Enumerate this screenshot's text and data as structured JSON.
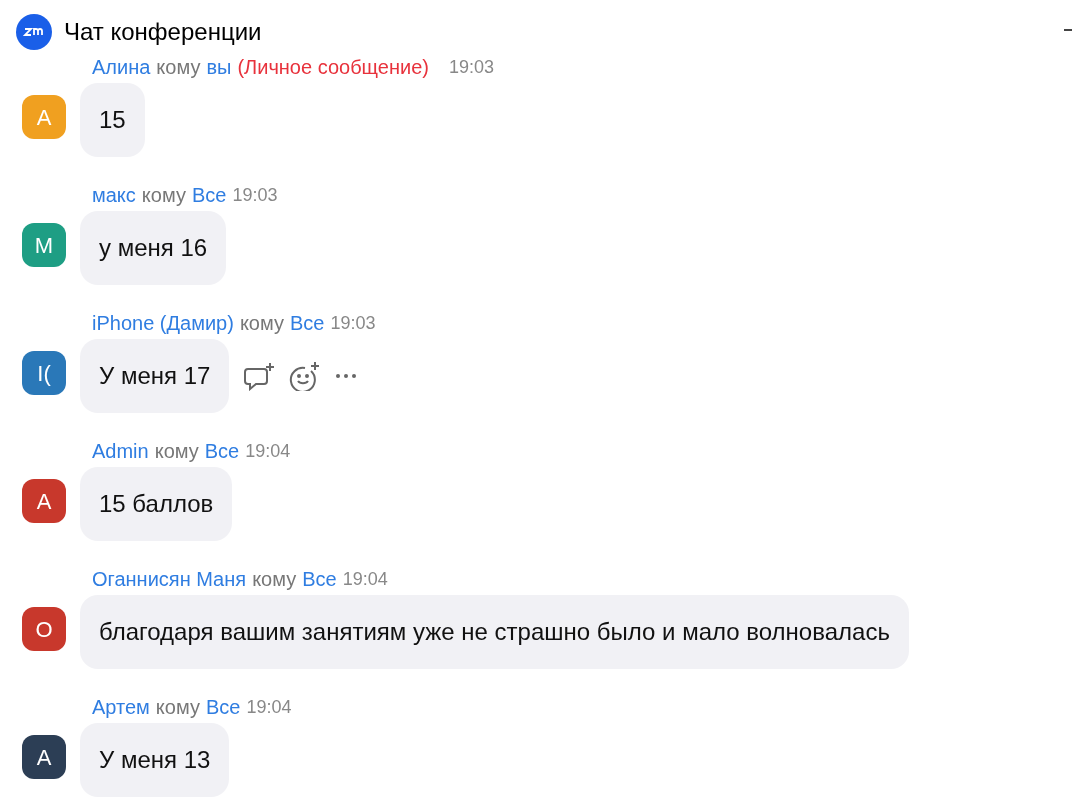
{
  "window": {
    "title": "Чат конференции"
  },
  "messages": [
    {
      "avatar": "А",
      "color": "#f0a020",
      "sender": "Алина",
      "to_word": "кому",
      "recipient": "вы",
      "private_note": "(Личное сообщение)",
      "time": "19:03",
      "text": "15",
      "hovered": false
    },
    {
      "avatar": "М",
      "color": "#1e9e84",
      "sender": "макс",
      "to_word": "кому",
      "recipient": "Все",
      "time": "19:03",
      "text": "у меня 16",
      "hovered": false
    },
    {
      "avatar": "I(",
      "color": "#2a78b8",
      "sender": "iPhone (Дамир)",
      "to_word": "кому",
      "recipient": "Все",
      "time": "19:03",
      "text": "У меня 17",
      "hovered": true
    },
    {
      "avatar": "A",
      "color": "#c8382c",
      "sender": "Admin",
      "to_word": "кому",
      "recipient": "Все",
      "time": "19:04",
      "text": "15 баллов",
      "hovered": false
    },
    {
      "avatar": "О",
      "color": "#c8382c",
      "sender": "Оганнисян Маня",
      "to_word": "кому",
      "recipient": "Все",
      "time": "19:04",
      "text": "благодаря вашим занятиям уже не страшно было и мало волновалась",
      "hovered": false
    },
    {
      "avatar": "А",
      "color": "#2c3e55",
      "sender": "Артем",
      "to_word": "кому",
      "recipient": "Все",
      "time": "19:04",
      "text": "У меня 13",
      "hovered": false
    }
  ]
}
